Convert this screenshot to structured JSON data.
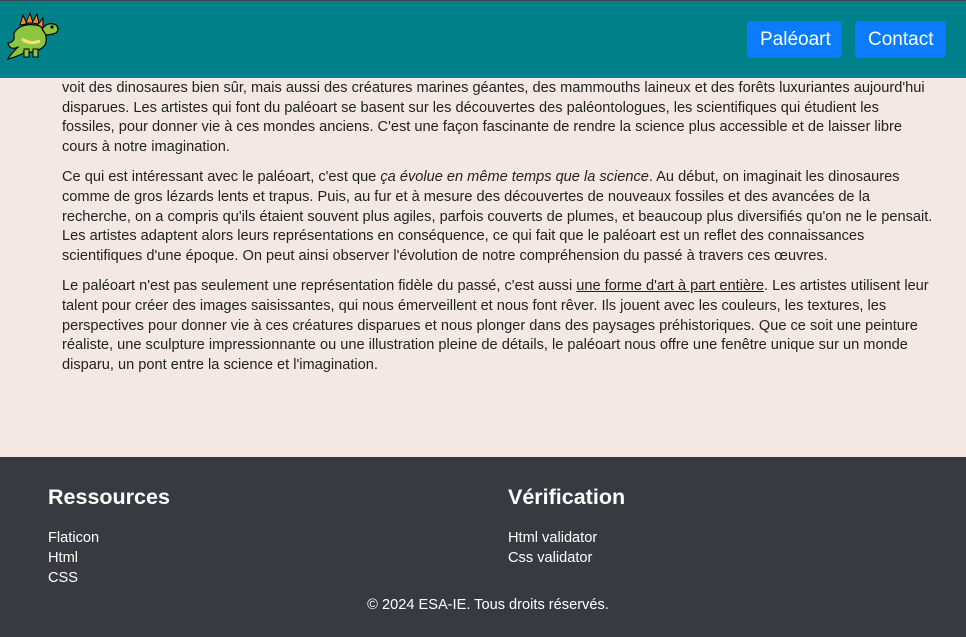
{
  "header": {
    "logo": "dinosaur-logo",
    "nav": [
      {
        "label": "Paléoart"
      },
      {
        "label": "Contact"
      }
    ]
  },
  "main": {
    "paragraphs": [
      {
        "text": "images de synthèse qui nous montrent à quoi pouvaient ressembler les animaux et les paysages d'il y a des millions d'années. On y voit des dinosaures bien sûr, mais aussi des créatures marines géantes, des mammouths laineux et des forêts luxuriantes aujourd'hui disparues. Les artistes qui font du paléoart se basent sur les découvertes des paléontologues, les scientifiques qui étudient les fossiles, pour donner vie à ces mondes anciens. C'est une façon fascinante de rendre la science plus accessible et de laisser libre cours à notre imagination."
      },
      {
        "before": "Ce qui est intéressant avec le paléoart, c'est que ",
        "emphasis": "ça évolue en même temps que la science",
        "after": ". Au début, on imaginait les dinosaures comme de gros lézards lents et trapus. Puis, au fur et à mesure des découvertes de nouveaux fossiles et des avancées de la recherche, on a compris qu'ils étaient souvent plus agiles, parfois couverts de plumes, et beaucoup plus diversifiés qu'on ne le pensait. Les artistes adaptent alors leurs représentations en conséquence, ce qui fait que le paléoart est un reflet des connaissances scientifiques d'une époque. On peut ainsi observer l'évolution de notre compréhension du passé à travers ces œuvres."
      },
      {
        "before": "Le paléoart n'est pas seulement une représentation fidèle du passé, c'est aussi ",
        "underline": "une forme d'art à part entière",
        "after": ". Les artistes utilisent leur talent pour créer des images saisissantes, qui nous émerveillent et nous font rêver. Ils jouent avec les couleurs, les textures, les perspectives pour donner vie à ces créatures disparues et nous plonger dans des paysages préhistoriques. Que ce soit une peinture réaliste, une sculpture impressionnante ou une illustration pleine de détails, le paléoart nous offre une fenêtre unique sur un monde disparu, un pont entre la science et l'imagination."
      }
    ]
  },
  "footer": {
    "resources": {
      "title": "Ressources",
      "links": [
        "Flaticon",
        "Html",
        "CSS"
      ]
    },
    "verification": {
      "title": "Vérification",
      "links": [
        "Html validator",
        "Css validator"
      ]
    },
    "copyright": "© 2024 ESA-IE. Tous droits réservés."
  },
  "colors": {
    "header_bg": "#00818a",
    "nav_button": "#0b7bff",
    "main_bg": "#f3e8e3",
    "footer_bg": "#383a42"
  }
}
